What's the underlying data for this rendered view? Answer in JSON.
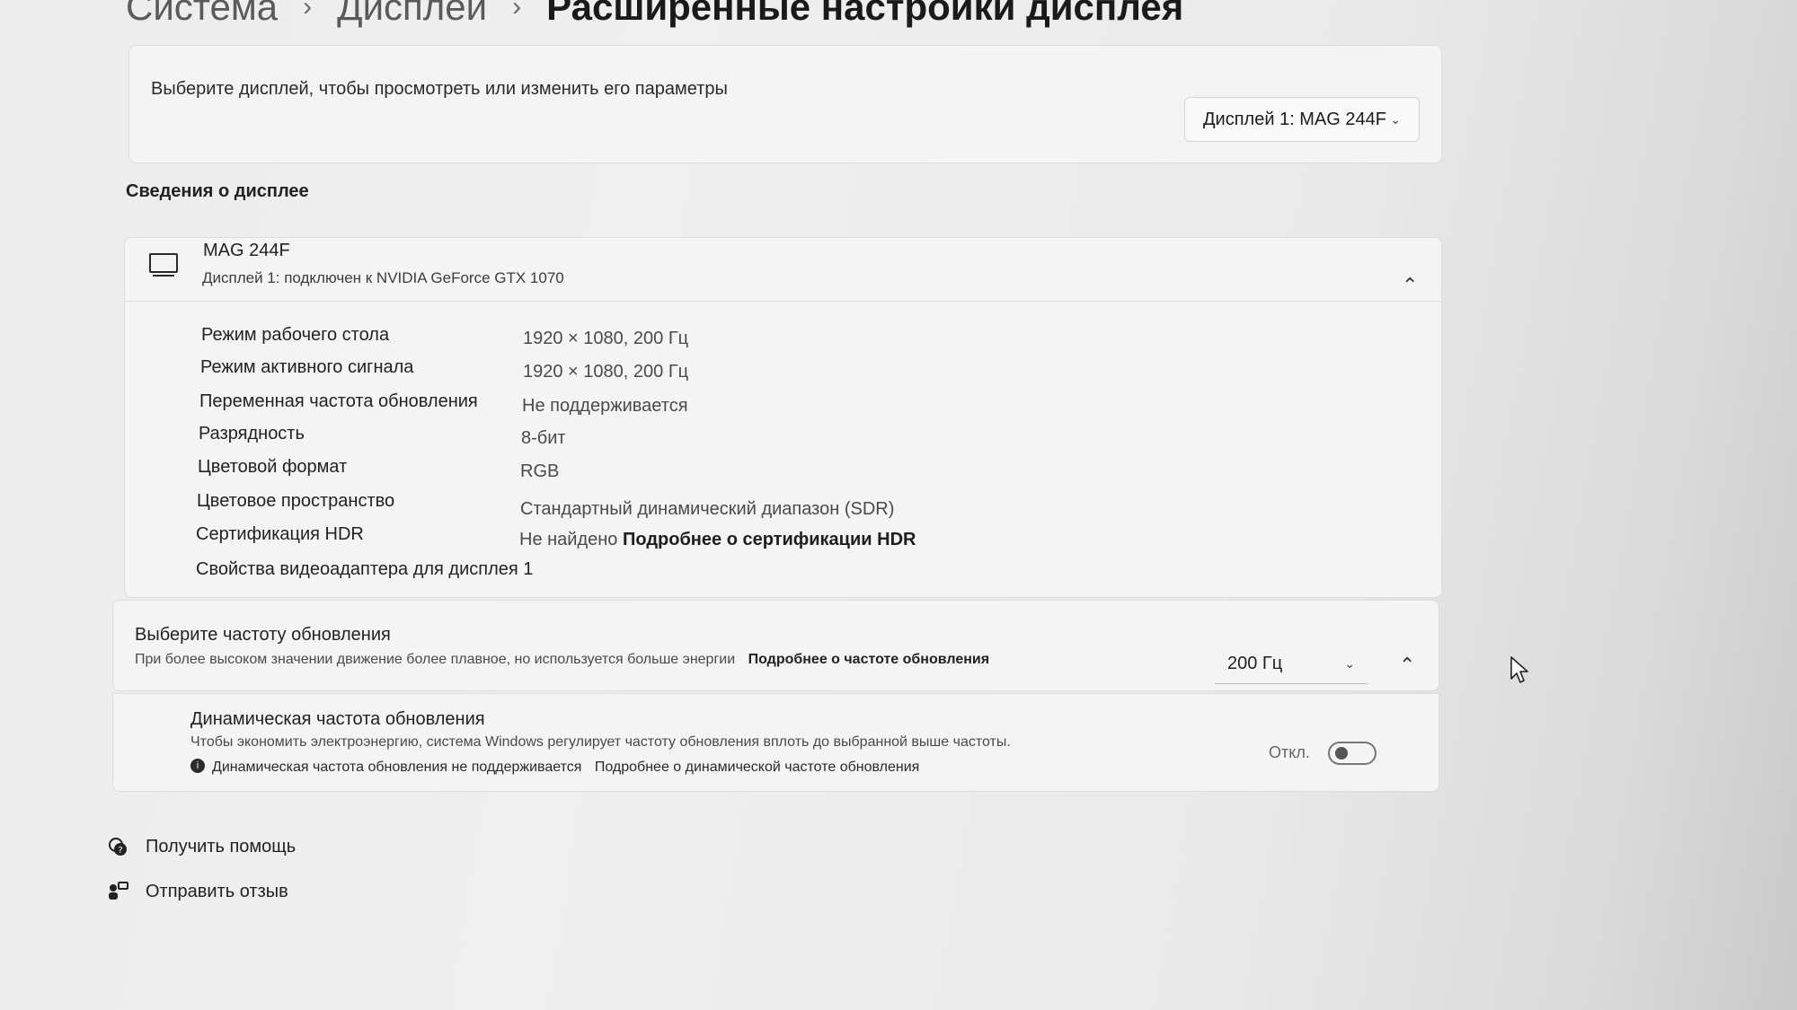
{
  "breadcrumb": {
    "items": [
      "Система",
      "Дисплей"
    ],
    "separator": "›",
    "current": "Расширенные настройки дисплея"
  },
  "display_selector": {
    "prompt": "Выберите дисплей, чтобы просмотреть или изменить его параметры",
    "selected": "Дисплей 1: MAG 244F"
  },
  "display_info": {
    "section_title": "Сведения о дисплее",
    "monitor_name": "MAG 244F",
    "monitor_subtitle": "Дисплей 1: подключен к NVIDIA GeForce GTX 1070",
    "rows": [
      {
        "label": "Режим рабочего стола",
        "value": "1920 × 1080, 200 Гц"
      },
      {
        "label": "Режим активного сигнала",
        "value": "1920 × 1080, 200 Гц"
      },
      {
        "label": "Переменная частота обновления",
        "value": "Не поддерживается"
      },
      {
        "label": "Разрядность",
        "value": "8-бит"
      },
      {
        "label": "Цветовой формат",
        "value": "RGB"
      },
      {
        "label": "Цветовое пространство",
        "value": "Стандартный динамический диапазон (SDR)"
      },
      {
        "label": "Сертификация HDR",
        "value": "Не найдено",
        "link": "Подробнее о сертификации HDR"
      }
    ],
    "adapter_link": "Свойства видеоадаптера для дисплея 1"
  },
  "refresh_rate": {
    "title": "Выберите частоту обновления",
    "description": "При более высоком значении движение более плавное, но используется больше энергии",
    "link": "Подробнее о частоте обновления",
    "selected": "200 Гц"
  },
  "dynamic_refresh": {
    "title": "Динамическая частота обновления",
    "description": "Чтобы экономить электроэнергию, система Windows регулирует частоту обновления вплоть до выбранной выше частоты.",
    "note": "Динамическая частота обновления не поддерживается",
    "link": "Подробнее о динамической частоте обновления",
    "toggle_label": "Откл.",
    "toggle_on": false
  },
  "footer": {
    "help": "Получить помощь",
    "feedback": "Отправить отзыв"
  }
}
